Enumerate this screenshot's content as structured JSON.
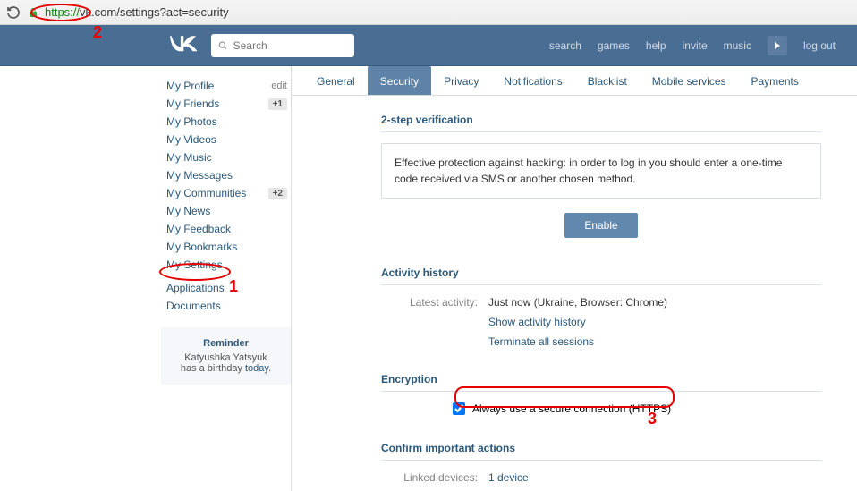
{
  "browser": {
    "url_scheme": "https://",
    "url_rest": "vk.com/settings?act=security"
  },
  "header": {
    "search_placeholder": "Search",
    "nav": {
      "search": "search",
      "games": "games",
      "help": "help",
      "invite": "invite",
      "music": "music",
      "logout": "log out"
    }
  },
  "sidebar": {
    "profile": "My Profile",
    "edit": "edit",
    "friends": "My Friends",
    "friends_badge": "+1",
    "photos": "My Photos",
    "videos": "My Videos",
    "music": "My Music",
    "messages": "My Messages",
    "communities": "My Communities",
    "communities_badge": "+2",
    "news": "My News",
    "feedback": "My Feedback",
    "bookmarks": "My Bookmarks",
    "settings": "My Settings",
    "applications": "Applications",
    "documents": "Documents",
    "reminder_title": "Reminder",
    "reminder_text_1": "Katyushka Yatsyuk",
    "reminder_text_2": "has a birthday ",
    "reminder_today": "today"
  },
  "tabs": {
    "general": "General",
    "security": "Security",
    "privacy": "Privacy",
    "notifications": "Notifications",
    "blacklist": "Blacklist",
    "mobile": "Mobile services",
    "payments": "Payments"
  },
  "content": {
    "twostep_title": "2-step verification",
    "twostep_desc": "Effective protection against hacking: in order to log in you should enter a one-time code received via SMS or another chosen method.",
    "enable": "Enable",
    "activity_title": "Activity history",
    "latest_label": "Latest activity:",
    "latest_val": "Just now (Ukraine, Browser: Chrome)",
    "show_history": "Show activity history",
    "terminate": "Terminate all sessions",
    "encryption_title": "Encryption",
    "https_label": "Always use a secure connection (HTTPS)",
    "confirm_title": "Confirm important actions",
    "linked_label": "Linked devices:",
    "linked_val": "1 device"
  },
  "annotations": {
    "n1": "1",
    "n2": "2",
    "n3": "3"
  }
}
